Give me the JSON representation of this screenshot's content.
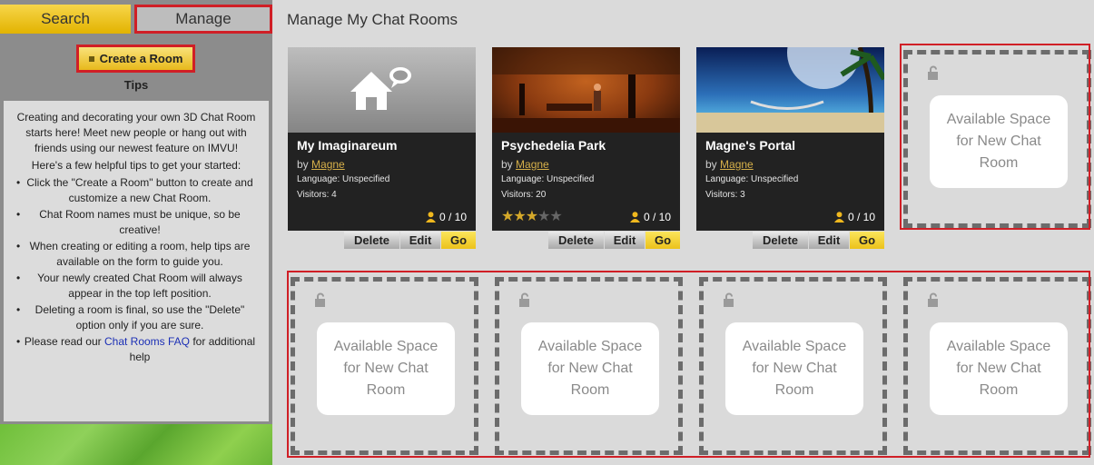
{
  "tabs": {
    "search": "Search",
    "manage": "Manage"
  },
  "sidebar": {
    "create_button": "Create a Room",
    "tips_heading": "Tips",
    "intro": "Creating and decorating your own 3D Chat Room starts here! Meet new people or hang out with friends using our newest feature on IMVU!",
    "tips_lead": "Here's a few helpful tips to get your started:",
    "tips": [
      "Click the \"Create a Room\" button to create and customize a new Chat Room.",
      "Chat Room names must be unique, so be creative!",
      "When creating or editing a room, help tips are available on the form to guide you.",
      "Your newly created Chat Room will always appear in the top left position.",
      "Deleting a room is final, so use the \"Delete\" option only if you are sure."
    ],
    "faq_prefix": "Please read our ",
    "faq_link": "Chat Rooms FAQ",
    "faq_suffix": " for additional help"
  },
  "main": {
    "title": "Manage My Chat Rooms",
    "by_label": "by",
    "actions": {
      "delete": "Delete",
      "edit": "Edit",
      "go": "Go"
    },
    "rooms": [
      {
        "name": "My Imaginareum",
        "owner": "Magne",
        "language": "Language: Unspecified",
        "visitors": "Visitors: 4",
        "capacity": "0 / 10",
        "rating": null
      },
      {
        "name": "Psychedelia Park",
        "owner": "Magne",
        "language": "Language: Unspecified",
        "visitors": "Visitors: 20",
        "capacity": "0 / 10",
        "rating": 3
      },
      {
        "name": "Magne's Portal",
        "owner": "Magne",
        "language": "Language: Unspecified",
        "visitors": "Visitors: 3",
        "capacity": "0 / 10",
        "rating": null
      }
    ],
    "available_slot_text": "Available Space for New Chat Room"
  },
  "colors": {
    "accent_yellow": "#ecc21b",
    "highlight_red": "#d01f26",
    "link_gold": "#d6b04a",
    "link_blue": "#1b2fb5"
  }
}
